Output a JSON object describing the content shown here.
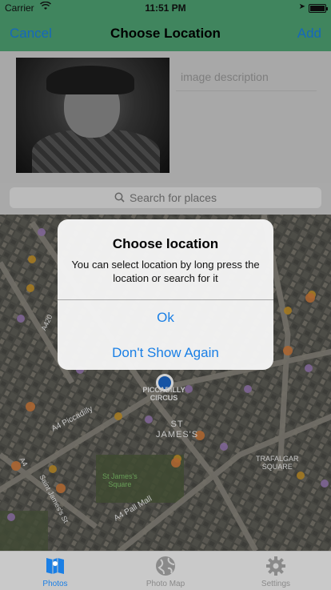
{
  "status": {
    "carrier": "Carrier",
    "time": "11:51 PM"
  },
  "nav": {
    "title": "Choose Location",
    "cancel": "Cancel",
    "add": "Add"
  },
  "form": {
    "description_placeholder": "image description"
  },
  "search": {
    "placeholder": "Search for places"
  },
  "map": {
    "labels": [
      "PICCADILLY",
      "CIRCUS",
      "ST",
      "JAMES'S",
      "A4 Piccadilly",
      "TRAFALGAR",
      "SQUARE",
      "St James's",
      "Square",
      "A4 Pall Mall",
      "Saint James's St",
      "A420",
      "A4"
    ]
  },
  "dialog": {
    "title": "Choose location",
    "message": "You can select location by long press the location or search for it",
    "ok": "Ok",
    "dont_show": "Don't Show Again"
  },
  "tabs": [
    {
      "label": "Photos",
      "icon": "map-book-icon",
      "active": true
    },
    {
      "label": "Photo Map",
      "icon": "globe-icon",
      "active": false
    },
    {
      "label": "Settings",
      "icon": "gear-icon",
      "active": false
    }
  ],
  "colors": {
    "accent": "#1a7fe5",
    "nav_bg": "#4fa373"
  }
}
